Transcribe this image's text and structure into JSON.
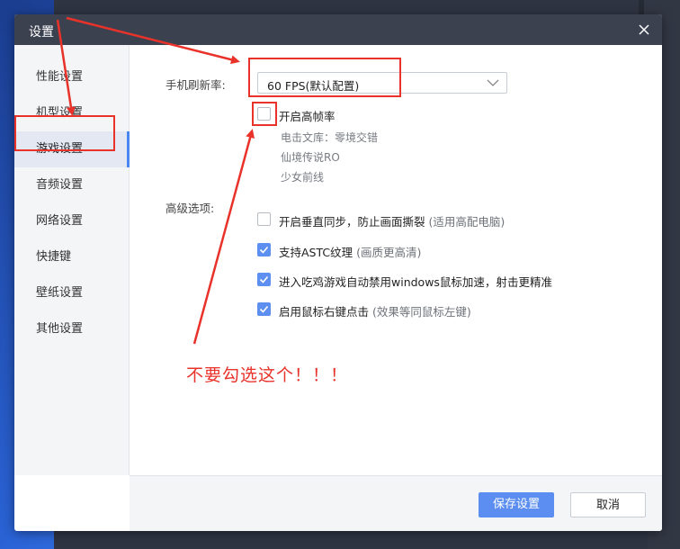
{
  "window": {
    "title": "设置"
  },
  "sidebar": {
    "items": [
      {
        "label": "性能设置",
        "active": false
      },
      {
        "label": "机型设置",
        "active": false
      },
      {
        "label": "游戏设置",
        "active": true
      },
      {
        "label": "音频设置",
        "active": false
      },
      {
        "label": "网络设置",
        "active": false
      },
      {
        "label": "快捷键",
        "active": false
      },
      {
        "label": "壁纸设置",
        "active": false
      },
      {
        "label": "其他设置",
        "active": false
      }
    ]
  },
  "refresh": {
    "label": "手机刷新率:",
    "selected": "60 FPS(默认配置)",
    "high_frame": {
      "label": "开启高帧率",
      "checked": false
    },
    "games": [
      "电击文库：零境交错",
      "仙境传说RO",
      "少女前线"
    ]
  },
  "advanced": {
    "label": "高级选项:",
    "options": [
      {
        "text": "开启垂直同步，防止画面撕裂",
        "hint": "(适用高配电脑)",
        "checked": false
      },
      {
        "text": "支持ASTC纹理",
        "hint": "(画质更高清)",
        "checked": true
      },
      {
        "text": "进入吃鸡游戏自动禁用windows鼠标加速，射击更精准",
        "hint": "",
        "checked": true
      },
      {
        "text": "启用鼠标右键点击",
        "hint": "(效果等同鼠标左键)",
        "checked": true
      }
    ]
  },
  "footer": {
    "save_label": "保存设置",
    "cancel_label": "取消"
  },
  "annotation": {
    "text": "不要勾选这个！！！",
    "color": "#e8322a"
  },
  "colors": {
    "accent": "#5b8ef0",
    "titlebar": "#3c4150",
    "annotation": "#e8322a"
  },
  "icons": {
    "close": "close-icon",
    "dropdown": "chevron-down-icon",
    "check": "checkmark-icon"
  }
}
